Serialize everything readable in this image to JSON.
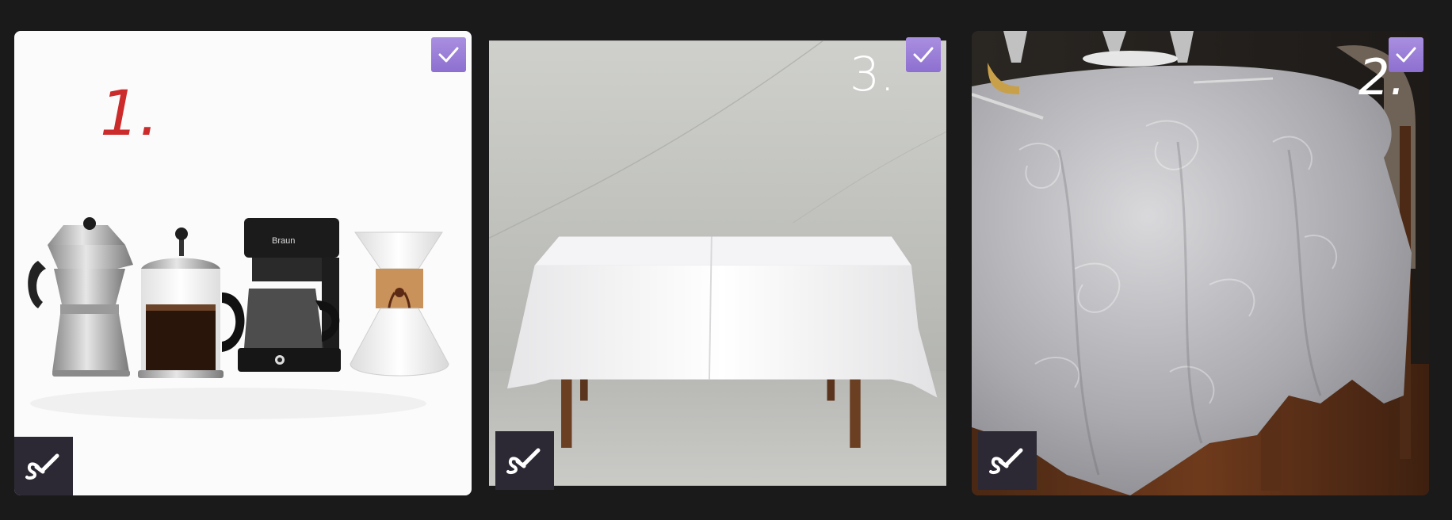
{
  "gallery": {
    "tiles": [
      {
        "id": "tile-coffee-makers",
        "number_label": "1.",
        "number_color": "#cc2b2b",
        "selected": true,
        "edit_icon": "brush-icon",
        "check_icon": "check-icon",
        "brand_text": "Braun"
      },
      {
        "id": "tile-white-tablecloth",
        "number_label": "3.",
        "number_color": "#ffffff",
        "selected": true,
        "edit_icon": "brush-icon",
        "check_icon": "check-icon"
      },
      {
        "id": "tile-silver-tablecloth",
        "number_label": "2.",
        "number_color": "#ffffff",
        "selected": true,
        "edit_icon": "brush-icon",
        "check_icon": "check-icon"
      }
    ],
    "accent_color": "#9a7fd8",
    "background_color": "#1a1a1a"
  }
}
